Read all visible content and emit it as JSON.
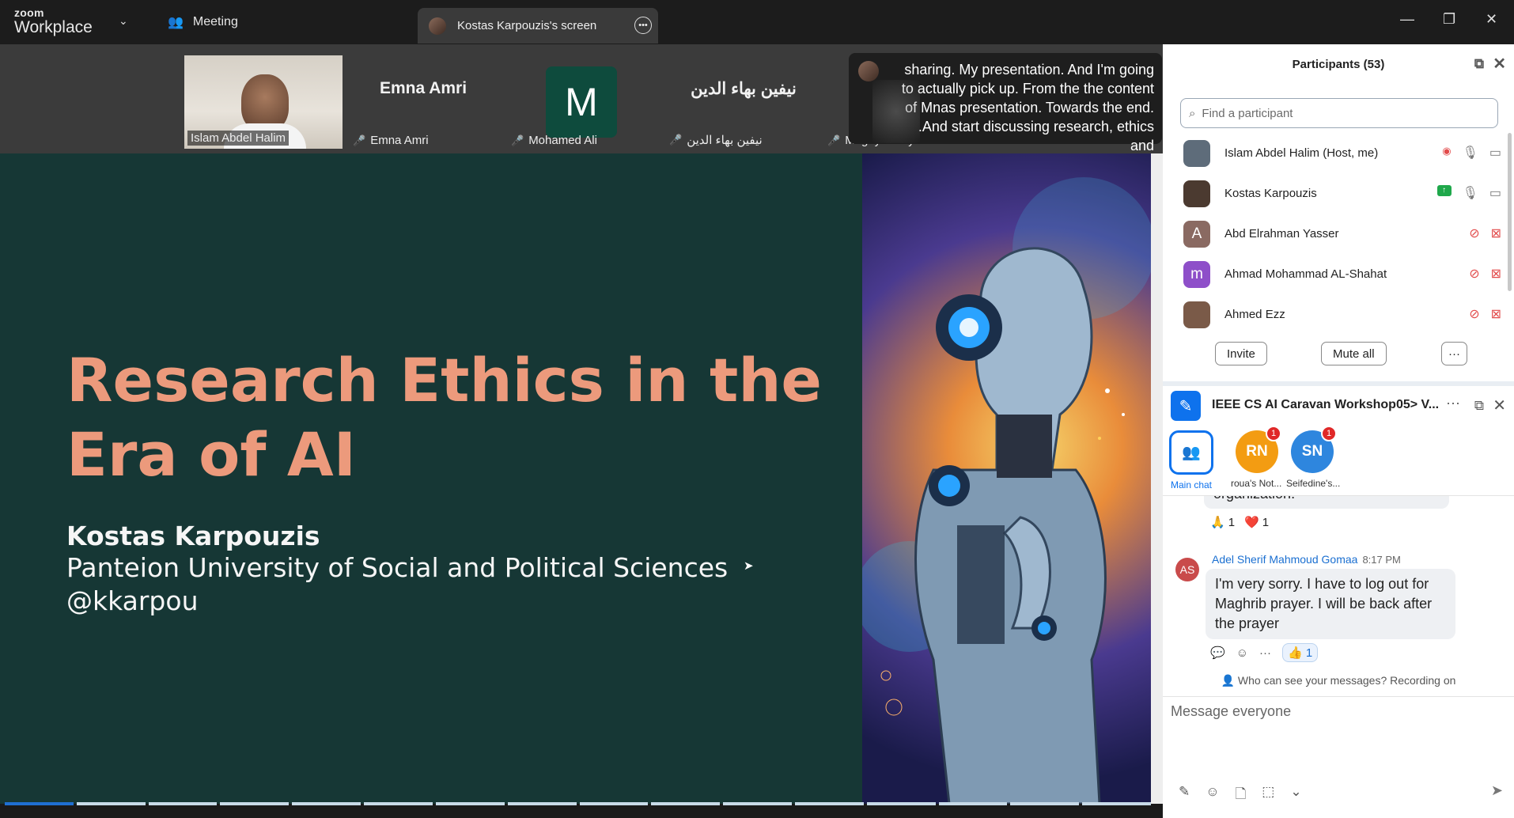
{
  "titlebar": {
    "logo_top": "zoom",
    "logo_bottom": "Workplace",
    "meeting_label": "Meeting",
    "share_tab_label": "Kostas Karpouzis's screen"
  },
  "gallery": [
    {
      "name": "Islam Abdel Halim"
    },
    {
      "name": "Emna Amri",
      "big_name": "Emna Amri"
    },
    {
      "name": "Mohamed Ali",
      "initial": "M"
    },
    {
      "name": "نيفين بهاء الدين",
      "big_name": "نيفين بهاء الدين"
    },
    {
      "name": "Magdy Samy Mostafa ..."
    }
  ],
  "caption": {
    "lines": [
      "sharing. My presentation. And I'm going",
      "to actually pick up. From the the content",
      "of Mnas presentation. Towards the end.",
      ".And start discussing research, ethics and"
    ]
  },
  "slide": {
    "title_line1": "Research Ethics in the",
    "title_line2": "Era of AI",
    "author": "Kostas Karpouzis",
    "affiliation": "Panteion University of Social and Political Sciences",
    "handle": "@kkarpou",
    "title_color": "#ec9a7c",
    "background_color": "#163735",
    "progress": {
      "segments": 16,
      "current": 1
    }
  },
  "participants": {
    "header": "Participants (53)",
    "search_placeholder": "Find a participant",
    "list": [
      {
        "name": "Islam Abdel Halim (Host, me)",
        "avatar_initial": "",
        "avatar_color": "#5e6c7a",
        "status": "host"
      },
      {
        "name": "Kostas Karpouzis",
        "avatar_initial": "",
        "avatar_color": "#4b3a30",
        "status": "sharing"
      },
      {
        "name": "Abd Elrahman Yasser",
        "avatar_initial": "A",
        "avatar_color": "#8a6a62",
        "status": "muted"
      },
      {
        "name": "Ahmad Mohammad AL-Shahat",
        "avatar_initial": "m",
        "avatar_color": "#8e4fc9",
        "status": "muted"
      },
      {
        "name": "Ahmed Ezz",
        "avatar_initial": "",
        "avatar_color": "#7a5a48",
        "status": "muted"
      }
    ],
    "invite_label": "Invite",
    "mute_all_label": "Mute all",
    "more_label": "···"
  },
  "chat": {
    "title": "IEEE CS AI Caravan Workshop05> V...",
    "chips": [
      {
        "label": "Main chat",
        "initials": "",
        "color": "#0e72ed",
        "badge": ""
      },
      {
        "label": "roua's Not...",
        "initials": "RN",
        "color": "#f39c12",
        "badge": "1"
      },
      {
        "label": "Seifedine's...",
        "initials": "SN",
        "color": "#2e86de",
        "badge": "1"
      }
    ],
    "prev_fragment": "organization.",
    "prev_reactions": [
      {
        "emoji": "🙏",
        "count": "1"
      },
      {
        "emoji": "❤️",
        "count": "1"
      }
    ],
    "message": {
      "sender_initials": "AS",
      "sender": "Adel Sherif Mahmoud Gomaa",
      "time": "8:17 PM",
      "text": "I'm very sorry. I have to log out for Maghrib prayer. I will be back after the prayer",
      "reaction_emoji": "👍",
      "reaction_count": "1"
    },
    "notice": "Who can see your messages? Recording on",
    "composer_placeholder": "Message everyone"
  }
}
